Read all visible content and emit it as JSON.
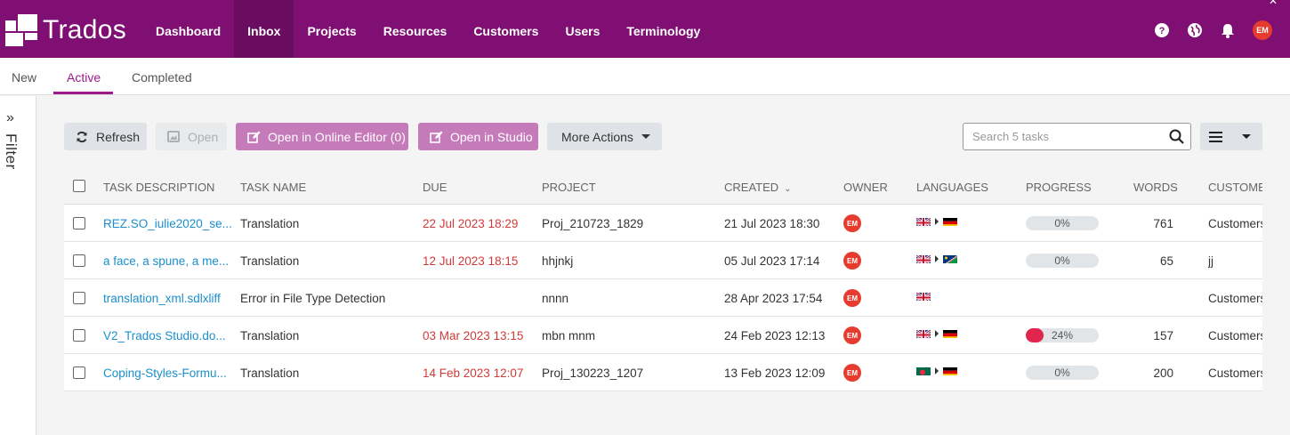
{
  "app": {
    "name": "Trados"
  },
  "nav": {
    "items": [
      {
        "label": "Dashboard",
        "active": false
      },
      {
        "label": "Inbox",
        "active": true
      },
      {
        "label": "Projects",
        "active": false
      },
      {
        "label": "Resources",
        "active": false
      },
      {
        "label": "Customers",
        "active": false
      },
      {
        "label": "Users",
        "active": false
      },
      {
        "label": "Terminology",
        "active": false
      }
    ],
    "avatar": "EM",
    "icons": [
      "help-icon",
      "globe-icon",
      "bell-icon"
    ]
  },
  "subtabs": [
    {
      "label": "New",
      "active": false
    },
    {
      "label": "Active",
      "active": true
    },
    {
      "label": "Completed",
      "active": false
    }
  ],
  "filter": {
    "label": "Filter"
  },
  "toolbar": {
    "refresh": "Refresh",
    "open": "Open",
    "online_editor": "Open in Online Editor (0)",
    "studio": "Open in Studio",
    "more_actions": "More Actions",
    "search_placeholder": "Search 5 tasks"
  },
  "table": {
    "headers": {
      "description": "TASK DESCRIPTION",
      "name": "TASK NAME",
      "due": "DUE",
      "project": "PROJECT",
      "created": "CREATED",
      "owner": "OWNER",
      "languages": "LANGUAGES",
      "progress": "PROGRESS",
      "words": "WORDS",
      "customer": "CUSTOMER"
    },
    "rows": [
      {
        "description": "REZ.SO_iulie2020_se...",
        "name": "Translation",
        "due": "22 Jul 2023 18:29",
        "project": "Proj_210723_1829",
        "created": "21 Jul 2023 18:30",
        "owner": "EM",
        "source_flag": "gb",
        "target_flag": "de",
        "progress": "0%",
        "progress_value": 0,
        "words": "761",
        "customer": "Customers"
      },
      {
        "description": "a face, a spune, a me...",
        "name": "Translation",
        "due": "12 Jul 2023 18:15",
        "project": "hhjnkj",
        "created": "05 Jul 2023 17:14",
        "owner": "EM",
        "source_flag": "gb",
        "target_flag": "na",
        "progress": "0%",
        "progress_value": 0,
        "words": "65",
        "customer": "jj"
      },
      {
        "description": "translation_xml.sdlxliff",
        "name": "Error in File Type Detection",
        "due": "",
        "project": "nnnn",
        "created": "28 Apr 2023 17:54",
        "owner": "EM",
        "source_flag": "gb",
        "target_flag": "",
        "progress": "",
        "progress_value": null,
        "words": "",
        "customer": "Customers"
      },
      {
        "description": "V2_Trados Studio.do...",
        "name": "Translation",
        "due": "03 Mar 2023 13:15",
        "project": "mbn mnm",
        "created": "24 Feb 2023 12:13",
        "owner": "EM",
        "source_flag": "gb",
        "target_flag": "de",
        "progress": "24%",
        "progress_value": 24,
        "words": "157",
        "customer": "Customers"
      },
      {
        "description": "Coping-Styles-Formu...",
        "name": "Translation",
        "due": "14 Feb 2023 12:07",
        "project": "Proj_130223_1207",
        "created": "13 Feb 2023 12:09",
        "owner": "EM",
        "source_flag": "bd",
        "target_flag": "de",
        "progress": "0%",
        "progress_value": 0,
        "words": "200",
        "customer": "Customers"
      }
    ]
  },
  "colors": {
    "brand": "#7f0f73",
    "accent": "#9b1b8d",
    "link": "#1b8fcc",
    "due": "#d23a3a",
    "avatar": "#e63c2f"
  }
}
